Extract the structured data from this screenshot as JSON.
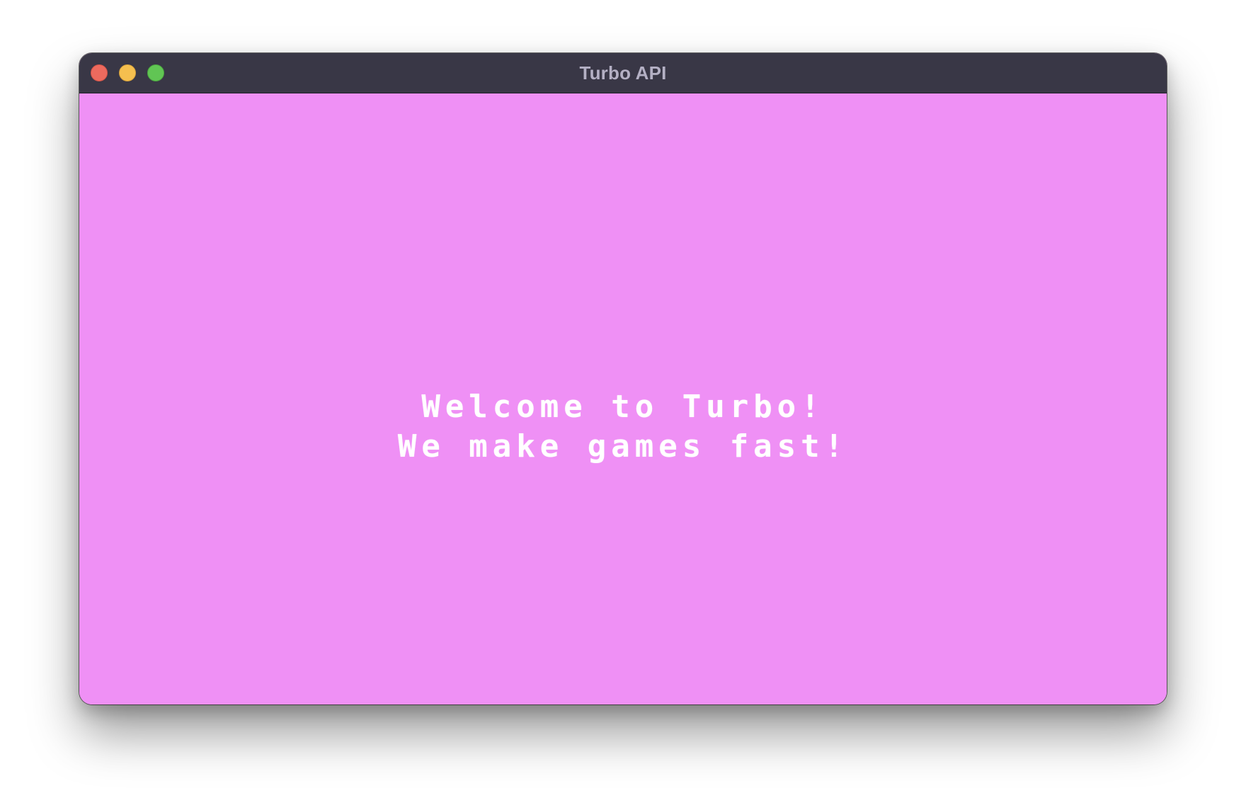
{
  "window": {
    "title": "Turbo API",
    "controls": {
      "close": "close-icon",
      "minimize": "minimize-icon",
      "zoom": "zoom-icon"
    }
  },
  "game": {
    "background_color": "#ef90f5",
    "text_color": "#ffffff",
    "lines": [
      "Welcome to Turbo!",
      "We make games fast!"
    ]
  },
  "colors": {
    "titlebar": "#393746",
    "close": "#ed6a5e",
    "minimize": "#f5bf4f",
    "zoom": "#61c554"
  }
}
